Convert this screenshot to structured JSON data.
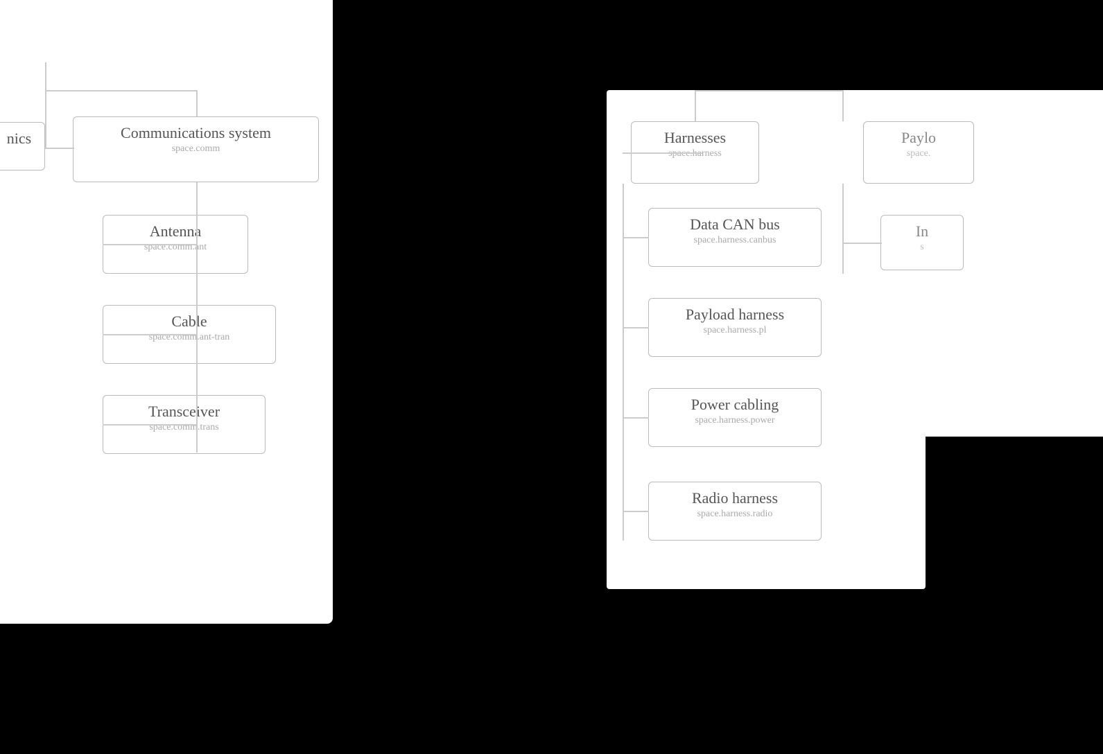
{
  "left_panel": {
    "comm_system": {
      "label": "Communications system",
      "sublabel": "space.comm"
    },
    "antenna": {
      "label": "Antenna",
      "sublabel": "space.comm.ant"
    },
    "cable": {
      "label": "Cable",
      "sublabel": "space.comm.ant-tran"
    },
    "transceiver": {
      "label": "Transceiver",
      "sublabel": "space.comm.trans"
    },
    "nics": {
      "label": "nics",
      "sublabel": ""
    }
  },
  "right_panel": {
    "harnesses": {
      "label": "Harnesses",
      "sublabel": "space.harness"
    },
    "data_can_bus": {
      "label": "Data CAN bus",
      "sublabel": "space.harness.canbus"
    },
    "payload_harness": {
      "label": "Payload harness",
      "sublabel": "space.harness.pl"
    },
    "power_cabling": {
      "label": "Power cabling",
      "sublabel": "space.harness.power"
    },
    "radio_harness": {
      "label": "Radio harness",
      "sublabel": "space.harness.radio"
    }
  },
  "far_right_panel": {
    "payload": {
      "label": "Paylo",
      "sublabel": "space."
    },
    "in_item": {
      "label": "In",
      "sublabel": "s"
    }
  }
}
